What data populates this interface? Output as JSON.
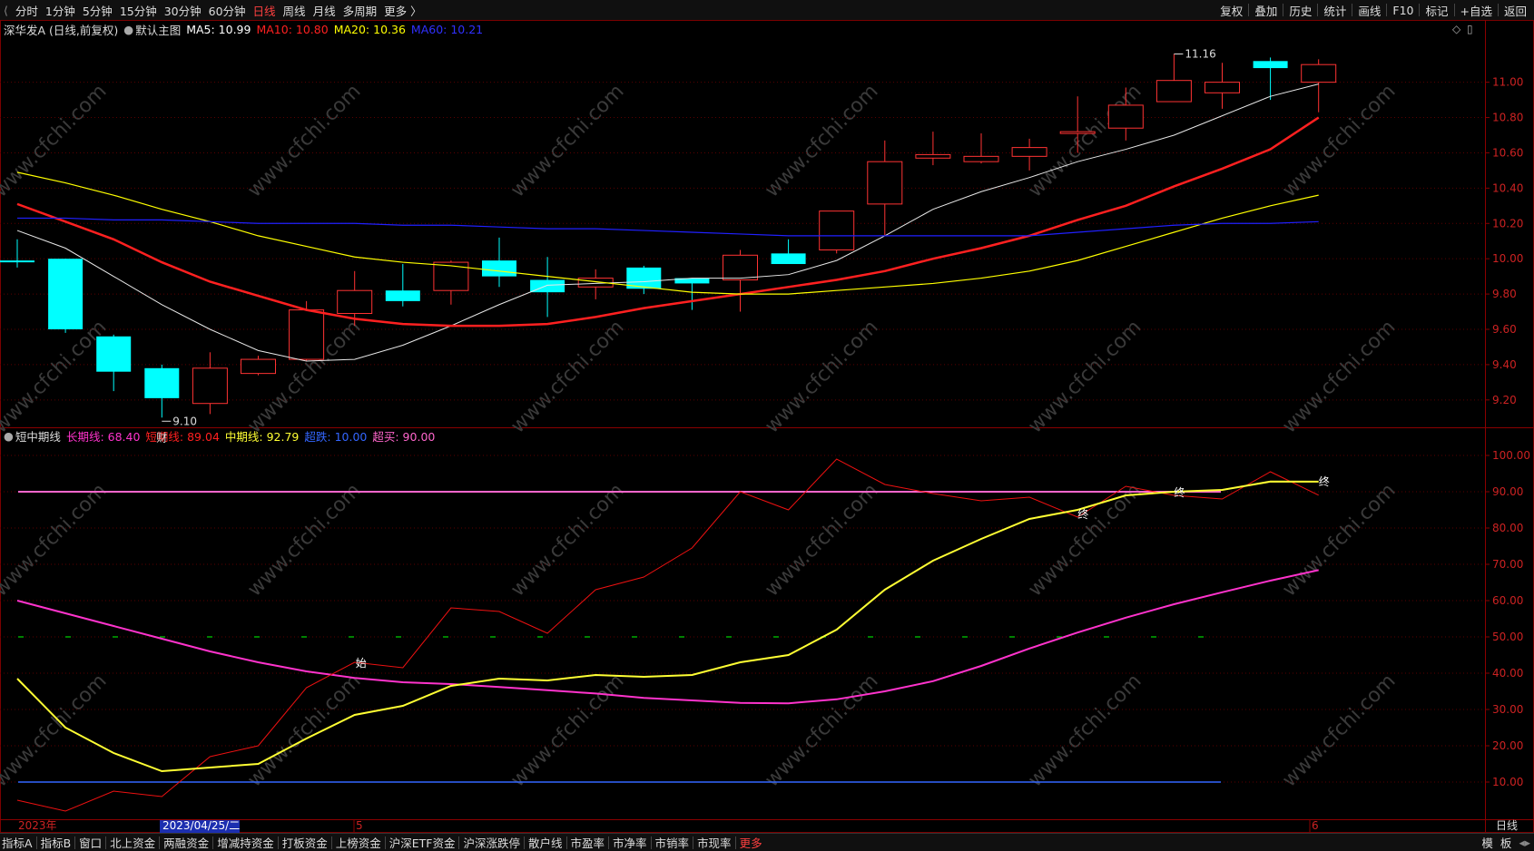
{
  "toolbar": {
    "periods": [
      "分时",
      "1分钟",
      "5分钟",
      "15分钟",
      "30分钟",
      "60分钟",
      "日线",
      "周线",
      "月线",
      "多周期",
      "更多 〉"
    ],
    "active_period": "日线",
    "right_items": [
      "复权",
      "叠加",
      "历史",
      "统计",
      "画线",
      "F10",
      "标记",
      "+自选",
      "返回"
    ]
  },
  "main_legend": {
    "stock": "深华发A (日线,前复权)",
    "template": "默认主图",
    "ma5": "MA5: 10.99",
    "ma10": "MA10: 10.80",
    "ma20": "MA20: 10.36",
    "ma60": "MA60: 10.21",
    "colors": {
      "ma5": "#ffffff",
      "ma10": "#ff2020",
      "ma20": "#ffff00",
      "ma60": "#2020ff"
    }
  },
  "sub_legend": {
    "name": "短中期线",
    "long": "长期线: 68.40",
    "short": "短期线: 89.04",
    "mid": "中期线: 92.79",
    "oversold": "超跌: 10.00",
    "overbought": "超买: 90.00",
    "colors": {
      "long": "#ff33cc",
      "short": "#ff2020",
      "mid": "#ffff33",
      "oversold": "#3366ff",
      "overbought": "#ff66cc"
    }
  },
  "x_axis": {
    "year_label": "2023年",
    "cursor_label": "2023/04/25/二",
    "month_labels": [
      "5",
      "6"
    ],
    "period_label": "日线"
  },
  "markers": {
    "low_label": "9.10",
    "high_label": "11.16",
    "cai_label": "财",
    "start_label": "始",
    "end_labels": [
      "终",
      "终",
      "终"
    ]
  },
  "bottom_tabs": [
    "指标A",
    "指标B",
    "窗口",
    "北上资金",
    "两融资金",
    "增减持资金",
    "打板资金",
    "上榜资金",
    "沪深ETF资金",
    "沪深涨跌停",
    "散户线",
    "市盈率",
    "市净率",
    "市销率",
    "市现率",
    "更多"
  ],
  "bottom_right": [
    "模",
    "板"
  ],
  "watermark": "www.cfchi.com",
  "chart_data": [
    {
      "type": "candlestick",
      "title": "深华发A (日线,前复权)",
      "ylim": [
        9.05,
        11.25
      ],
      "y_ticks": [
        "11.00",
        "10.80",
        "10.60",
        "10.40",
        "10.20",
        "10.00",
        "9.80",
        "9.60",
        "9.40",
        "9.20"
      ],
      "candles": [
        {
          "o": 9.99,
          "h": 10.11,
          "l": 9.95,
          "c": 9.98
        },
        {
          "o": 10.0,
          "h": 10.0,
          "l": 9.58,
          "c": 9.6
        },
        {
          "o": 9.56,
          "h": 9.57,
          "l": 9.25,
          "c": 9.36
        },
        {
          "o": 9.38,
          "h": 9.4,
          "l": 9.1,
          "c": 9.21
        },
        {
          "o": 9.18,
          "h": 9.47,
          "l": 9.12,
          "c": 9.38
        },
        {
          "o": 9.35,
          "h": 9.45,
          "l": 9.34,
          "c": 9.43
        },
        {
          "o": 9.43,
          "h": 9.76,
          "l": 9.42,
          "c": 9.71
        },
        {
          "o": 9.69,
          "h": 9.93,
          "l": 9.62,
          "c": 9.82
        },
        {
          "o": 9.82,
          "h": 9.97,
          "l": 9.73,
          "c": 9.76
        },
        {
          "o": 9.82,
          "h": 9.99,
          "l": 9.74,
          "c": 9.98
        },
        {
          "o": 9.99,
          "h": 10.12,
          "l": 9.84,
          "c": 9.9
        },
        {
          "o": 9.88,
          "h": 10.01,
          "l": 9.67,
          "c": 9.81
        },
        {
          "o": 9.84,
          "h": 9.94,
          "l": 9.77,
          "c": 9.89
        },
        {
          "o": 9.95,
          "h": 9.96,
          "l": 9.8,
          "c": 9.83
        },
        {
          "o": 9.89,
          "h": 9.89,
          "l": 9.71,
          "c": 9.86
        },
        {
          "o": 9.88,
          "h": 10.05,
          "l": 9.7,
          "c": 10.02
        },
        {
          "o": 10.03,
          "h": 10.11,
          "l": 9.98,
          "c": 9.97
        },
        {
          "o": 10.05,
          "h": 10.27,
          "l": 10.03,
          "c": 10.27
        },
        {
          "o": 10.31,
          "h": 10.67,
          "l": 10.13,
          "c": 10.55
        },
        {
          "o": 10.57,
          "h": 10.72,
          "l": 10.53,
          "c": 10.59
        },
        {
          "o": 10.55,
          "h": 10.71,
          "l": 10.54,
          "c": 10.58
        },
        {
          "o": 10.58,
          "h": 10.68,
          "l": 10.5,
          "c": 10.63
        },
        {
          "o": 10.72,
          "h": 10.92,
          "l": 10.6,
          "c": 10.72
        },
        {
          "o": 10.74,
          "h": 10.97,
          "l": 10.67,
          "c": 10.87
        },
        {
          "o": 10.89,
          "h": 11.16,
          "l": 10.89,
          "c": 11.01
        },
        {
          "o": 10.94,
          "h": 11.11,
          "l": 10.85,
          "c": 11.0
        },
        {
          "o": 11.12,
          "h": 11.14,
          "l": 10.9,
          "c": 11.08
        },
        {
          "o": 11.0,
          "h": 11.13,
          "l": 10.83,
          "c": 11.1
        }
      ],
      "series": [
        {
          "name": "MA5",
          "values": [
            10.16,
            10.06,
            9.9,
            9.74,
            9.6,
            9.48,
            9.42,
            9.43,
            9.51,
            9.62,
            9.74,
            9.85,
            9.86,
            9.87,
            9.89,
            9.89,
            9.91,
            9.99,
            10.13,
            10.28,
            10.38,
            10.46,
            10.55,
            10.62,
            10.7,
            10.81,
            10.92,
            10.99
          ]
        },
        {
          "name": "MA10",
          "values": [
            10.31,
            10.21,
            10.11,
            9.98,
            9.87,
            9.79,
            9.71,
            9.66,
            9.63,
            9.62,
            9.62,
            9.63,
            9.67,
            9.72,
            9.76,
            9.8,
            9.84,
            9.88,
            9.93,
            10.0,
            10.06,
            10.13,
            10.22,
            10.3,
            10.41,
            10.51,
            10.62,
            10.8
          ]
        },
        {
          "name": "MA20",
          "values": [
            10.49,
            10.43,
            10.36,
            10.28,
            10.21,
            10.13,
            10.07,
            10.01,
            9.98,
            9.96,
            9.93,
            9.9,
            9.87,
            9.84,
            9.81,
            9.8,
            9.8,
            9.82,
            9.84,
            9.86,
            9.89,
            9.93,
            9.99,
            10.07,
            10.15,
            10.23,
            10.3,
            10.36
          ]
        },
        {
          "name": "MA60",
          "values": [
            10.23,
            10.23,
            10.22,
            10.22,
            10.21,
            10.2,
            10.2,
            10.2,
            10.19,
            10.19,
            10.18,
            10.17,
            10.17,
            10.16,
            10.15,
            10.14,
            10.13,
            10.13,
            10.13,
            10.13,
            10.13,
            10.13,
            10.15,
            10.17,
            10.19,
            10.2,
            10.2,
            10.21
          ]
        }
      ]
    },
    {
      "type": "line",
      "title": "短中期线",
      "ylim": [
        0,
        103
      ],
      "y_ticks": [
        "100.00",
        "90.00",
        "80.00",
        "70.00",
        "60.00",
        "50.00",
        "40.00",
        "30.00",
        "20.00",
        "10.00"
      ],
      "reference_lines": [
        {
          "name": "超买",
          "value": 90
        },
        {
          "name": "超跌",
          "value": 10
        },
        {
          "name": "",
          "value": 50
        }
      ],
      "series": [
        {
          "name": "长期线",
          "values": [
            60.0,
            56.5,
            53.0,
            49.5,
            46.0,
            43.0,
            40.5,
            38.7,
            37.5,
            37.0,
            36.2,
            35.3,
            34.4,
            33.2,
            32.5,
            31.8,
            31.7,
            32.8,
            35.0,
            37.8,
            42.0,
            46.8,
            51.2,
            55.3,
            59.0,
            62.3,
            65.5,
            68.4
          ]
        },
        {
          "name": "短期线",
          "values": [
            5.0,
            2.0,
            7.5,
            6.0,
            17.0,
            20.0,
            36.0,
            43.0,
            41.5,
            58.0,
            57.0,
            51.0,
            63.0,
            66.5,
            74.5,
            90.0,
            85.0,
            99.0,
            92.0,
            89.5,
            87.5,
            88.5,
            83.0,
            91.5,
            89.0,
            88.0,
            95.5,
            89.04
          ]
        },
        {
          "name": "中期线",
          "values": [
            38.5,
            25.0,
            18.0,
            13.0,
            14.0,
            15.0,
            22.0,
            28.5,
            31.0,
            36.5,
            38.5,
            38.0,
            39.5,
            39.0,
            39.5,
            43.0,
            45.0,
            52.0,
            63.0,
            71.0,
            77.0,
            82.5,
            85.0,
            89.0,
            90.0,
            90.5,
            92.8,
            92.79
          ]
        }
      ]
    }
  ]
}
